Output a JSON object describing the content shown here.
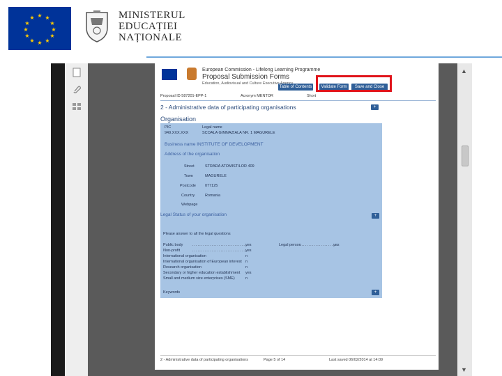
{
  "header": {
    "ministry_lines": [
      "MINISTERUL",
      "EDUCAȚIEI",
      "NAȚIONALE"
    ]
  },
  "form": {
    "doc_line1": "European Commission - Lifelong Learning Programme",
    "title": "Proposal Submission Forms",
    "agency": "Education, Audiovisual and Culture Executive Agency",
    "buttons": {
      "table_of_contents": "Table of Contents",
      "validate_form": "Validate Form",
      "save_and_close": "Save and Close"
    },
    "meta": {
      "proposal_id": "Proposal ID 587201-EPP-1",
      "acronym": "Acronym  MENTOR",
      "short": "Short"
    },
    "section_title": "2 - Administrative data of participating organisations",
    "subsection_title": "Organisation",
    "add_button": "+",
    "panel": {
      "pic": "PIC",
      "legal_name": "Legal name",
      "pic_number": "949.XXX.XXX",
      "legal_name_value": "SCOALA GIMNAZIALA NR. 1 MAGURELE",
      "business_name_link": "Business name INSTITUTE OF DEVELOPMENT",
      "address_link": "Address of the organisation",
      "street_label": "Street",
      "street_value": "STRADA ATOMISTILOR 409",
      "town_label": "Town",
      "town_value": "MAGURELE",
      "postcode_label": "Postcode",
      "postcode_value": "077125",
      "country_label": "Country",
      "country_value": "Romania",
      "webpage_label": "Webpage",
      "legal_status_link": "Legal Status of your organisation",
      "legal_status_text": "Please answer to all the legal questions",
      "public_body": "Public body",
      "nonprofit": "Non-profit",
      "international_org": "International organisation",
      "international_org_eu": "International organisation of European interest",
      "research_org": "Research organisation",
      "education_est": "Secondary or higher education establishment",
      "small_medium": "Small and medium size enterprises (SME)",
      "legal_person": "Legal person",
      "yes": "yes",
      "n": "n",
      "keywords": "Keywords"
    },
    "footer": {
      "left": "2 - Administrative data of participating organisations",
      "page": "Page 5 of 14",
      "timestamp": "Last saved 06/02/2014 at 14:09"
    }
  },
  "colors": {
    "eu_blue": "#003399",
    "highlight_red": "#e0141b",
    "panel_blue": "#a7c4e4",
    "button_blue": "#2f5f98"
  },
  "icons": [
    "eu-flag-icon",
    "romania-crest-icon",
    "page-icon",
    "attachment-icon",
    "layers-icon"
  ]
}
